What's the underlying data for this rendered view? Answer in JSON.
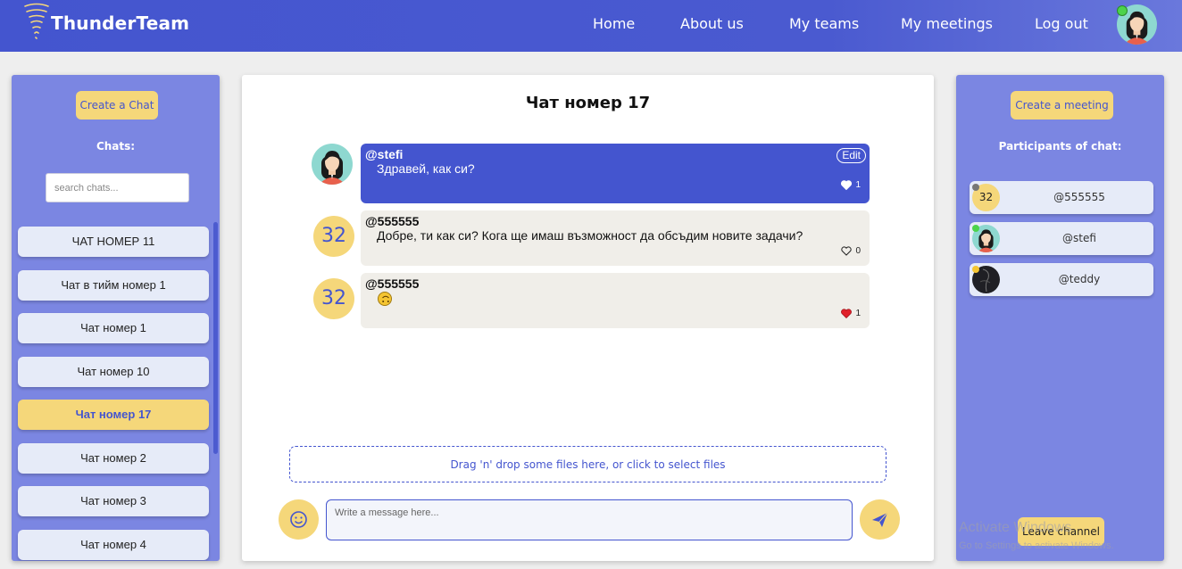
{
  "navbar": {
    "brand": "ThunderTeam",
    "links": [
      "Home",
      "About us",
      "My teams",
      "My meetings",
      "Log out"
    ],
    "user_status_color": "#4cd34c"
  },
  "left_panel": {
    "create_chat_label": "Create a Chat",
    "chats_heading": "Chats:",
    "search_placeholder": "search chats...",
    "chats": [
      {
        "label": "ЧАТ НОМЕР 11",
        "active": false
      },
      {
        "label": "Чат в тийм номер 1",
        "active": false
      },
      {
        "label": "Чат номер 1",
        "active": false
      },
      {
        "label": "Чат номер 10",
        "active": false
      },
      {
        "label": "Чат номер 17",
        "active": true
      },
      {
        "label": "Чат номер 2",
        "active": false
      },
      {
        "label": "Чат номер 3",
        "active": false
      },
      {
        "label": "Чат номер 4",
        "active": false
      }
    ]
  },
  "chat": {
    "title": "Чат номер 17",
    "messages": [
      {
        "author": "@stefi",
        "text": "Здравей, как си?",
        "avatar": "stefi-avatar",
        "mine": true,
        "edit_label": "Edit",
        "likes": "1",
        "liked": false
      },
      {
        "author": "@555555",
        "text": "Добре, ти как си? Кога ще имаш възможност да обсъдим новите задачи?",
        "avatar_text": "32",
        "mine": false,
        "likes": "0",
        "liked": false
      },
      {
        "author": "@555555",
        "text": "",
        "emoji": "upside-down-face-emoji",
        "avatar_text": "32",
        "mine": false,
        "likes": "1",
        "liked": true
      }
    ],
    "dropzone_label": "Drag 'n' drop some files here, or click to select files",
    "input_placeholder": "Write a message here..."
  },
  "right_panel": {
    "create_meeting_label": "Create a meeting",
    "participants_heading": "Participants of chat:",
    "participants": [
      {
        "name": "@555555",
        "avatar_text": "32",
        "status_color": "#777777"
      },
      {
        "name": "@stefi",
        "avatar": "stefi-avatar",
        "status_color": "#4cd34c"
      },
      {
        "name": "@teddy",
        "avatar": "teddy-avatar",
        "status_color": "#f5c531"
      }
    ],
    "leave_label": "Leave channel"
  },
  "watermark": {
    "line1": "Activate Windows",
    "line2": "Go to Settings to activate Windows."
  },
  "colors": {
    "primary": "#4455cf",
    "panel": "#7b86e2",
    "accent_yellow": "#f5d77a",
    "bubble_other": "#f0eee9",
    "heart_liked": "#e0202a"
  }
}
